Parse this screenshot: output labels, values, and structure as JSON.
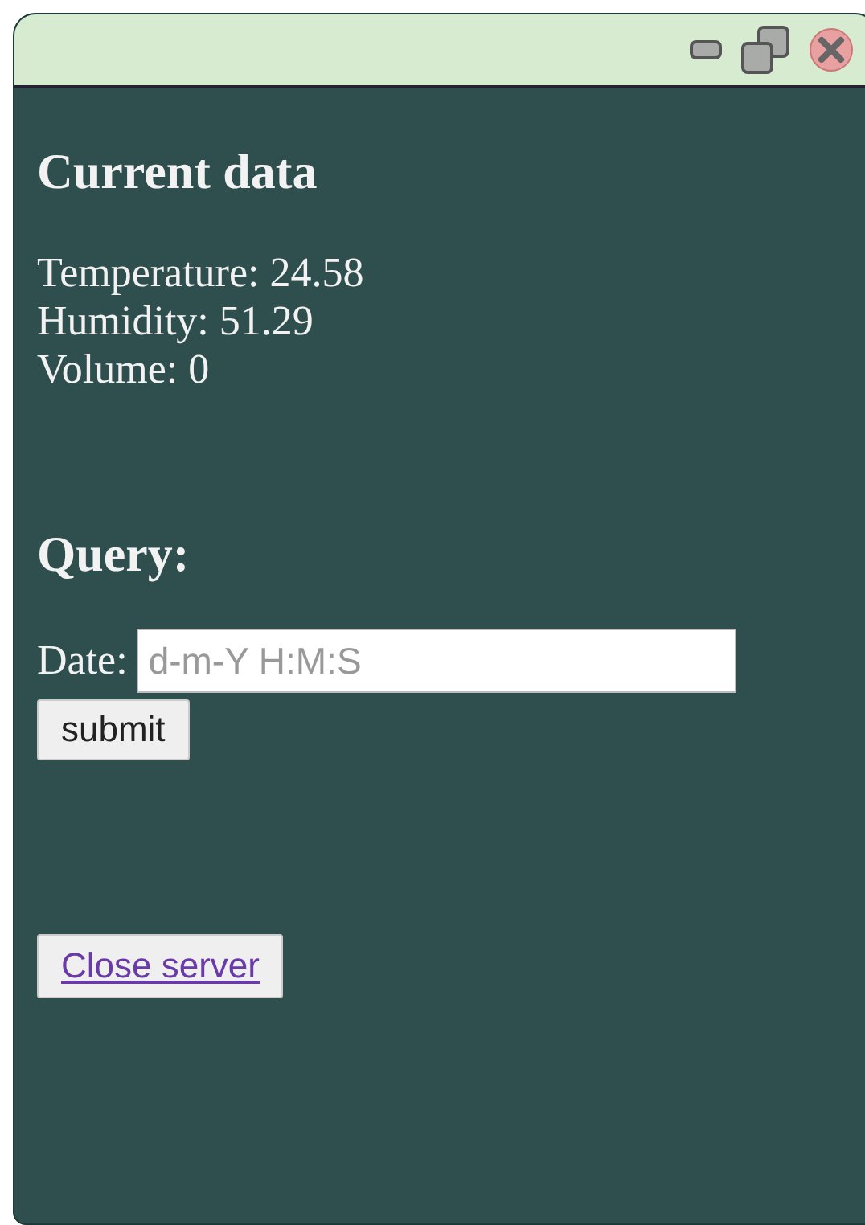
{
  "title_bar": {
    "controls": [
      {
        "kind": "minimize"
      },
      {
        "kind": "restore"
      },
      {
        "kind": "close"
      }
    ]
  },
  "current": {
    "heading": "Current data",
    "readings": [
      "Temperature: 24.58",
      "Humidity: 51.29",
      "Volume: 0"
    ]
  },
  "query": {
    "heading": "Query:",
    "date_label": "Date:",
    "date_placeholder": "d-m-Y H:M:S",
    "submit": "submit"
  },
  "close_server": "Close server"
}
